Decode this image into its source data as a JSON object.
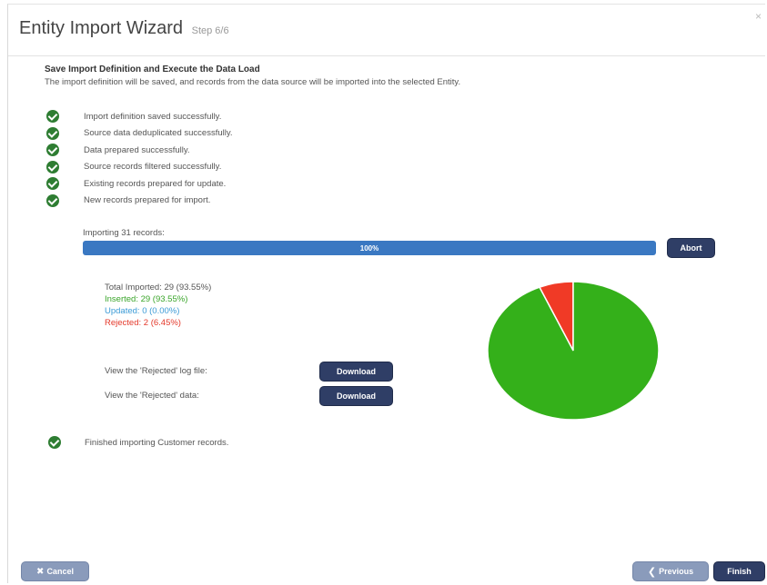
{
  "header": {
    "title": "Entity Import Wizard",
    "step": "Step 6/6",
    "close": "×"
  },
  "intro": {
    "title": "Save Import Definition and Execute the Data Load",
    "text": "The import definition will be saved, and records from the data source will be imported into the selected Entity."
  },
  "steps": [
    "Import definition saved successfully.",
    "Source data deduplicated successfully.",
    "Data prepared successfully.",
    "Source records filtered successfully.",
    "Existing records prepared for update.",
    "New records prepared for import."
  ],
  "progress": {
    "label": "Importing 31 records:",
    "percent_text": "100%",
    "fraction": 1.0,
    "abort_label": "Abort"
  },
  "stats": {
    "total": "Total Imported: 29 (93.55%)",
    "inserted": "Inserted: 29 (93.55%)",
    "updated": "Updated: 0 (0.00%)",
    "rejected": "Rejected: 2 (6.45%)"
  },
  "downloads": {
    "log_label": "View the 'Rejected' log file:",
    "data_label": "View the 'Rejected' data:",
    "button_label": "Download"
  },
  "chart_data": {
    "type": "pie",
    "slices": [
      {
        "label": "Inserted",
        "value": 29,
        "color": "#34b01a"
      },
      {
        "label": "Rejected",
        "value": 2,
        "color": "#f03a26"
      }
    ]
  },
  "finished": "Finished importing Customer records.",
  "footer": {
    "cancel_label": "Cancel",
    "cancel_icon": "close-icon",
    "previous_label": "Previous",
    "previous_icon": "chevron-left-icon",
    "finish_label": "Finish"
  },
  "colors": {
    "check": "#2e7d32",
    "progress": "#3a78c2",
    "primary_button": "#2f3e66",
    "secondary_button": "#8a9bbb"
  }
}
